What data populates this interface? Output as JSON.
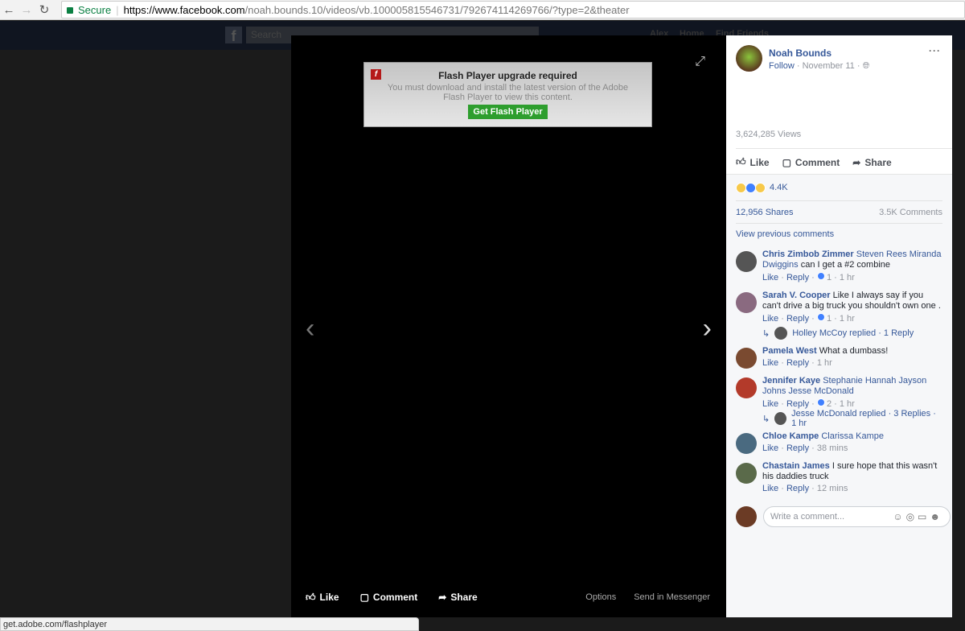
{
  "browser": {
    "secure_label": "Secure",
    "url_host": "https://www.facebook.com",
    "url_path": "/noah.bounds.10/videos/vb.100005815546731/792674114269766/?type=2&theater",
    "status_url": "get.adobe.com/flashplayer"
  },
  "fb_header": {
    "search_placeholder": "Search",
    "nav": [
      "Alex",
      "Home",
      "Find Friends"
    ]
  },
  "flash": {
    "title": "Flash Player upgrade required",
    "text": "You must download and install the latest version of the Adobe Flash Player to view this content.",
    "button": "Get Flash Player"
  },
  "video_bar": {
    "like": "Like",
    "comment": "Comment",
    "share": "Share",
    "options": "Options",
    "send": "Send in Messenger"
  },
  "post": {
    "author": "Noah Bounds",
    "follow": "Follow",
    "date": " · November 11 · ",
    "views": "3,624,285 Views",
    "like": "Like",
    "comment": "Comment",
    "share": "Share",
    "reactions": "4.4K",
    "shares": "12,956 Shares",
    "comments_count": "3.5K Comments",
    "view_previous": "View previous comments"
  },
  "comments": [
    {
      "name": "Chris Zimbob Zimmer",
      "tags": "Steven Rees Miranda Dwiggins",
      "text": "can I get a #2 combine",
      "reactions": "1",
      "time": "1 hr",
      "avatar_color": "#555"
    },
    {
      "name": "Sarah V. Cooper",
      "tags": "",
      "text": "Like I always say if you can't drive a big truck you shouldn't own one .",
      "reactions": "1",
      "time": "1 hr",
      "avatar_color": "#8a6a80",
      "reply": "Holley McCoy replied · 1 Reply"
    },
    {
      "name": "Pamela West",
      "tags": "",
      "text": "What a dumbass!",
      "reactions": "",
      "time": "1 hr",
      "avatar_color": "#7a4a30"
    },
    {
      "name": "Jennifer Kaye",
      "tags": "Stephanie Hannah Jayson Johns Jesse McDonald",
      "text": "",
      "reactions": "2",
      "time": "1 hr",
      "avatar_color": "#b33a2a",
      "reply": "Jesse McDonald replied · 3 Replies · 1 hr"
    },
    {
      "name": "Chloe Kampe",
      "tags": "Clarissa Kampe",
      "text": "",
      "reactions": "",
      "time": "38 mins",
      "avatar_color": "#4a6a80"
    },
    {
      "name": "Chastain James",
      "tags": "",
      "text": "I sure hope that this wasn't his daddies truck",
      "reactions": "",
      "time": "12 mins",
      "avatar_color": "#5a6a4a"
    }
  ],
  "comment_actions": {
    "like": "Like",
    "reply": "Reply"
  },
  "write_placeholder": "Write a comment...",
  "colors": {
    "link": "#365899",
    "flash_button": "#2e9e2e",
    "secure": "#0b8043"
  }
}
